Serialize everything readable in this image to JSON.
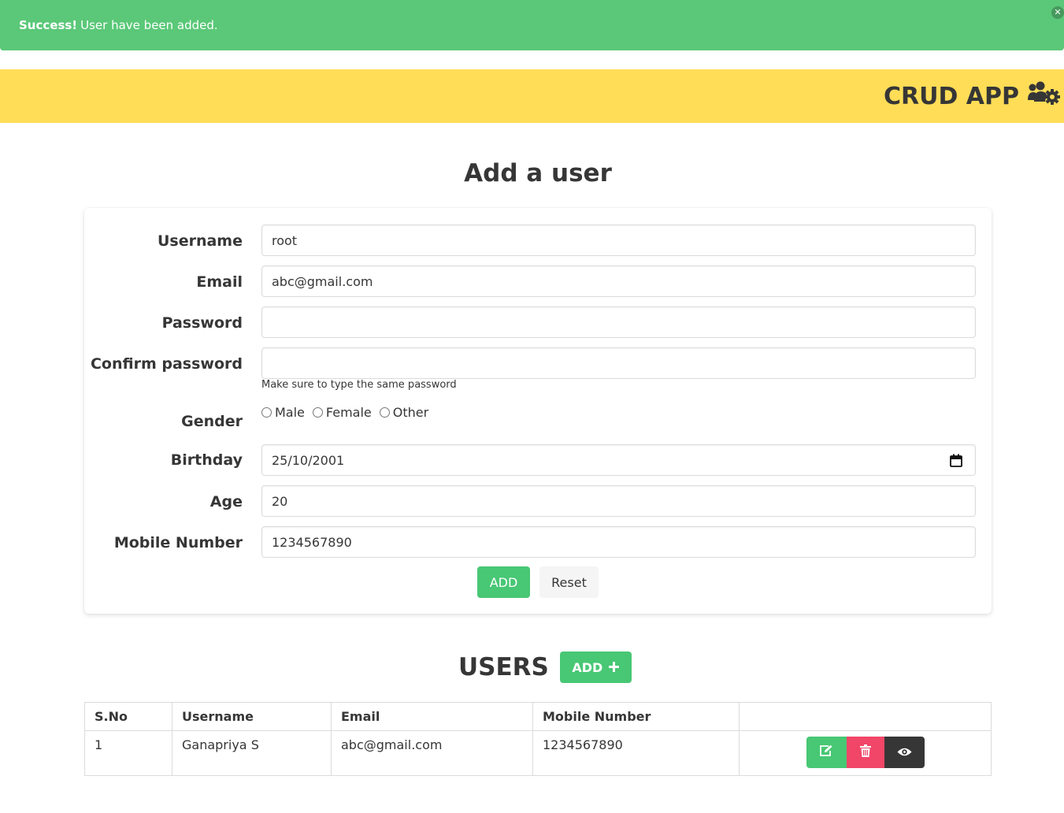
{
  "alert": {
    "strong": "Success!",
    "message": "User have been added."
  },
  "navbar": {
    "brand": "CRUD APP",
    "brand_icon": "users-cog-icon"
  },
  "form": {
    "title": "Add a user",
    "username_label": "Username",
    "username_value": "root",
    "email_label": "Email",
    "email_value": "abc@gmail.com",
    "password_label": "Password",
    "password_value": "",
    "confirm_label": "Confirm password",
    "confirm_value": "",
    "confirm_help": "Make sure to type the same password",
    "gender_label": "Gender",
    "gender_options": [
      "Male",
      "Female",
      "Other"
    ],
    "birthday_label": "Birthday",
    "birthday_value": "25/10/2001",
    "age_label": "Age",
    "age_value": "20",
    "mobile_label": "Mobile Number",
    "mobile_value": "1234567890",
    "add_label": "ADD",
    "reset_label": "Reset"
  },
  "users": {
    "title": "USERS",
    "add_label": "ADD",
    "columns": [
      "S.No",
      "Username",
      "Email",
      "Mobile Number",
      ""
    ],
    "rows": [
      {
        "sno": "1",
        "username": "Ganapriya S",
        "email": "abc@gmail.com",
        "mobile": "1234567890"
      }
    ]
  },
  "colors": {
    "success": "#48c774",
    "warning": "#ffdd57",
    "danger": "#f14668",
    "dark": "#363636"
  }
}
